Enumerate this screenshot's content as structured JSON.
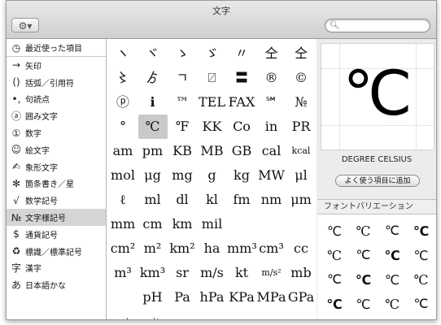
{
  "window": {
    "title": "文字"
  },
  "toolbar": {
    "gear_label": "⚙▾",
    "search_placeholder": ""
  },
  "sidebar": {
    "items": [
      {
        "icon": "◷",
        "icon_name": "clock-icon",
        "label": "最近使った項目"
      },
      {
        "icon": "→",
        "icon_name": "arrow-icon",
        "label": "矢印"
      },
      {
        "icon": "()",
        "icon_name": "parentheses-icon",
        "label": "括弧／引用符"
      },
      {
        "icon": "•,",
        "icon_name": "punctuation-icon",
        "label": "句読点"
      },
      {
        "icon": "ⓐ",
        "icon_name": "circled-letter-icon",
        "label": "囲み文字"
      },
      {
        "icon": "①",
        "icon_name": "circled-number-icon",
        "label": "数字"
      },
      {
        "icon": "☺",
        "icon_name": "smiley-icon",
        "label": "絵文字"
      },
      {
        "icon": "✍",
        "icon_name": "writing-hand-icon",
        "label": "象形文字"
      },
      {
        "icon": "✻",
        "icon_name": "asterisk-icon",
        "label": "箇条書き／星"
      },
      {
        "icon": "√",
        "icon_name": "square-root-icon",
        "label": "数学記号"
      },
      {
        "icon": "№",
        "icon_name": "numero-icon",
        "label": "文字様記号"
      },
      {
        "icon": "$",
        "icon_name": "dollar-icon",
        "label": "通貨記号"
      },
      {
        "icon": "♻",
        "icon_name": "recycle-icon",
        "label": "標識／標準記号"
      },
      {
        "icon": "字",
        "icon_name": "kanji-icon",
        "label": "漢字"
      },
      {
        "icon": "あ",
        "icon_name": "hiragana-icon",
        "label": "日本語かな"
      }
    ],
    "selected_index": 10
  },
  "character_grid": {
    "rows": [
      [
        "ヽ",
        "ヾ",
        "ゝ",
        "ゞ",
        "〃",
        "仝",
        "仝"
      ],
      [
        "〻",
        "ゟ",
        "ㄱ",
        "⍁",
        "〓",
        "®",
        "©"
      ],
      [
        "ⓟ",
        "ℹ",
        "™",
        "TEL",
        "FAX",
        "℠",
        "№"
      ],
      [
        "°",
        "℃",
        "℉",
        "KK",
        "Co",
        "in",
        "PR"
      ],
      [
        "am",
        "pm",
        "KB",
        "MB",
        "GB",
        "cal",
        "kcal"
      ],
      [
        "mol",
        "μg",
        "mg",
        "g",
        "kg",
        "MW",
        "μl"
      ],
      [
        "ℓ",
        "ml",
        "dl",
        "kl",
        "fm",
        "nm",
        "μm"
      ],
      [
        "mm",
        "cm",
        "km",
        "mil",
        "",
        "",
        ""
      ],
      [
        "cm²",
        "m²",
        "km²",
        "ha",
        "mm³",
        "cm³",
        "cc"
      ],
      [
        "m³",
        "km³",
        "sr",
        "m/s",
        "kt",
        "m/s²",
        "mb"
      ],
      [
        "",
        "pH",
        "Pa",
        "hPa",
        "KPa",
        "MPa",
        "GPa"
      ],
      [
        "rad",
        "rad/s",
        "",
        "",
        "",
        "",
        ""
      ]
    ],
    "selected": "℃"
  },
  "preview": {
    "glyph": "℃",
    "name": "DEGREE CELSIUS",
    "favorite_button": "よく使う項目に追加"
  },
  "font_variations": {
    "header": "フォントバリエーション",
    "glyphs": [
      "℃",
      "℃",
      "℃",
      "℃",
      "℃",
      "℃",
      "℃",
      "℃",
      "℃",
      "℃",
      "℃",
      "℃",
      "℃",
      "℃",
      "℃",
      "℃"
    ]
  }
}
